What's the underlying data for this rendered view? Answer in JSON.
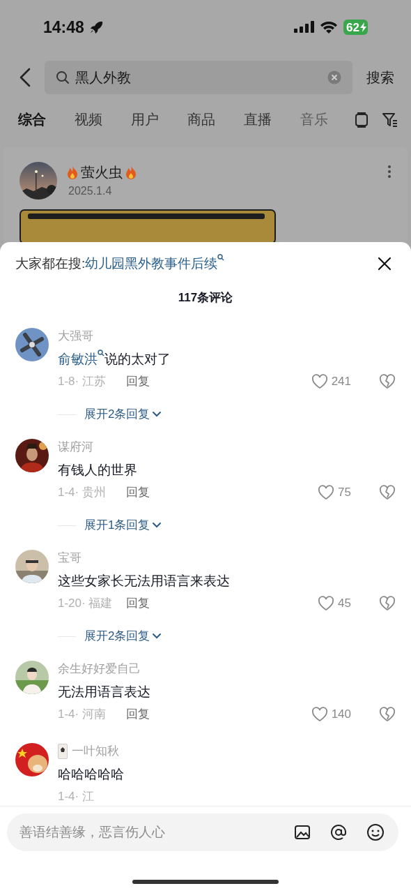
{
  "status_bar": {
    "time": "14:48",
    "battery": "62"
  },
  "search": {
    "query": "黑人外教",
    "button": "搜索"
  },
  "tabs": [
    {
      "label": "综合",
      "selected": true
    },
    {
      "label": "视频",
      "selected": false
    },
    {
      "label": "用户",
      "selected": false
    },
    {
      "label": "商品",
      "selected": false
    },
    {
      "label": "直播",
      "selected": false
    },
    {
      "label": "音乐",
      "selected": false,
      "faded": true
    }
  ],
  "post": {
    "author": "萤火虫",
    "date": "2025.1.4"
  },
  "comments_sheet": {
    "suggestion_label": "大家都在搜:",
    "suggestion": "幼儿园黑外教事件后续",
    "count": "117条评论",
    "comments": [
      {
        "name": "大强哥",
        "text": [
          {
            "kind": "link",
            "text": "俞敏洪"
          },
          {
            "kind": "plain",
            "text": "说的太对了"
          }
        ],
        "meta": "1-8· 江苏",
        "reply": "回复",
        "likes": "241",
        "expand": "展开2条回复"
      },
      {
        "name": "谋府河",
        "text": [
          {
            "kind": "plain",
            "text": "有钱人的世界"
          }
        ],
        "meta": "1-4· 贵州",
        "reply": "回复",
        "likes": "75",
        "expand": "展开1条回复"
      },
      {
        "name": "宝哥",
        "text": [
          {
            "kind": "plain",
            "text": "这些女家长无法用语言来表达"
          }
        ],
        "meta": "1-20· 福建",
        "reply": "回复",
        "likes": "45",
        "expand": "展开2条回复"
      },
      {
        "name": "余生好好爱自己",
        "text": [
          {
            "kind": "plain",
            "text": "无法用语言表达"
          }
        ],
        "meta": "1-4· 河南",
        "reply": "回复",
        "likes": "140"
      },
      {
        "name": "一叶知秋",
        "badge": true,
        "text": [
          {
            "kind": "plain",
            "text": "哈哈哈哈哈"
          }
        ],
        "meta": "1-4· 江"
      }
    ],
    "input": {
      "placeholder": "善语结善缘，恶言伤人心"
    }
  }
}
